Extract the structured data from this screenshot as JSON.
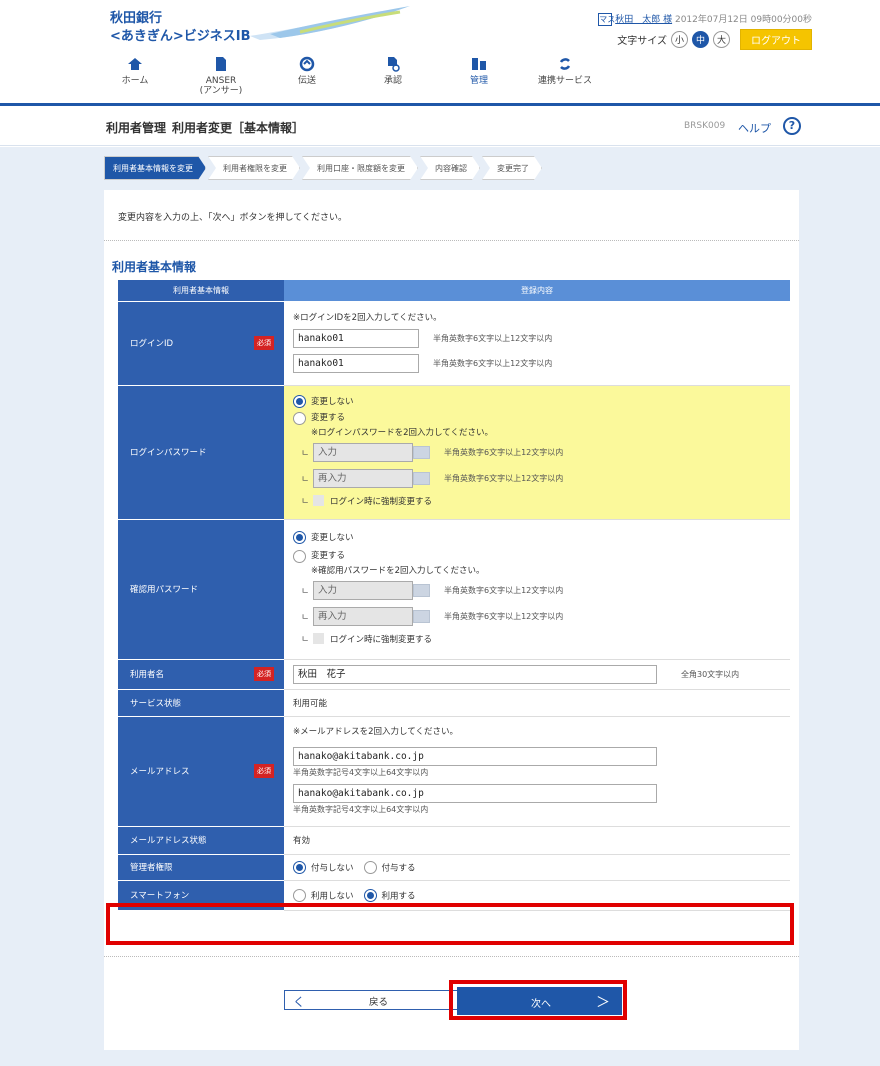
{
  "header": {
    "bank_line1": "秋田銀行",
    "bank_line2": "<あきぎん>ビジネスIB",
    "user_icon": "マス",
    "user_name": "秋田　太郎 様",
    "datetime": "2012年07月12日 09時00分00秒",
    "font_size_label": "文字サイズ",
    "font_small": "小",
    "font_medium": "中",
    "font_large": "大",
    "logout": "ログアウト"
  },
  "nav": [
    {
      "label": "ホーム",
      "icon": "home-icon"
    },
    {
      "label": "ANSER\n(アンサー)",
      "icon": "document-icon"
    },
    {
      "label": "伝送",
      "icon": "transfer-icon"
    },
    {
      "label": "承認",
      "icon": "approve-icon"
    },
    {
      "label": "管理",
      "icon": "manage-icon"
    },
    {
      "label": "連携サービス",
      "icon": "link-icon"
    }
  ],
  "title": {
    "section": "利用者管理",
    "page": "利用者変更［基本情報］",
    "code": "BRSK009",
    "help": "ヘルプ",
    "help_icon": "?"
  },
  "steps": [
    "利用者基本情報を変更",
    "利用者権限を変更",
    "利用口座・限度額を変更",
    "内容確認",
    "変更完了"
  ],
  "intro": "変更内容を入力の上、「次へ」ボタンを押してください。",
  "section_title": "利用者基本情報",
  "table": {
    "head1": "利用者基本情報",
    "head2": "登録内容",
    "required": "必須",
    "login_id": {
      "label": "ログインID",
      "note": "※ログインIDを2回入力してください。",
      "value1": "hanako01",
      "value2": "hanako01",
      "hint": "半角英数字6文字以上12文字以内"
    },
    "login_pw": {
      "label": "ログインパスワード",
      "opt_keep": "変更しない",
      "opt_change": "変更する",
      "note": "※ログインパスワードを2回入力してください。",
      "input": "入力",
      "reinput": "再入力",
      "hint": "半角英数字6文字以上12文字以内",
      "force": "ログイン時に強制変更する"
    },
    "confirm_pw": {
      "label": "確認用パスワード",
      "opt_keep": "変更しない",
      "opt_change": "変更する",
      "note": "※確認用パスワードを2回入力してください。",
      "input": "入力",
      "reinput": "再入力",
      "hint": "半角英数字6文字以上12文字以内",
      "force": "ログイン時に強制変更する"
    },
    "user_name": {
      "label": "利用者名",
      "value": "秋田　花子",
      "hint": "全角30文字以内"
    },
    "service": {
      "label": "サービス状態",
      "value": "利用可能"
    },
    "email": {
      "label": "メールアドレス",
      "note": "※メールアドレスを2回入力してください。",
      "value1": "hanako@akitabank.co.jp",
      "value2": "hanako@akitabank.co.jp",
      "hint": "半角英数字記号4文字以上64文字以内"
    },
    "email_status": {
      "label": "メールアドレス状態",
      "value": "有効"
    },
    "admin": {
      "label": "管理者権限",
      "opt1": "付与しない",
      "opt2": "付与する"
    },
    "smartphone": {
      "label": "スマートフォン",
      "opt1": "利用しない",
      "opt2": "利用する"
    }
  },
  "buttons": {
    "back": "戻る",
    "next": "次へ",
    "back_arrow": "く",
    "next_arrow": "＞"
  },
  "colors": {
    "primary": "#1f57a8",
    "highlight": "#e00000",
    "yellow": "#fbf99b"
  }
}
